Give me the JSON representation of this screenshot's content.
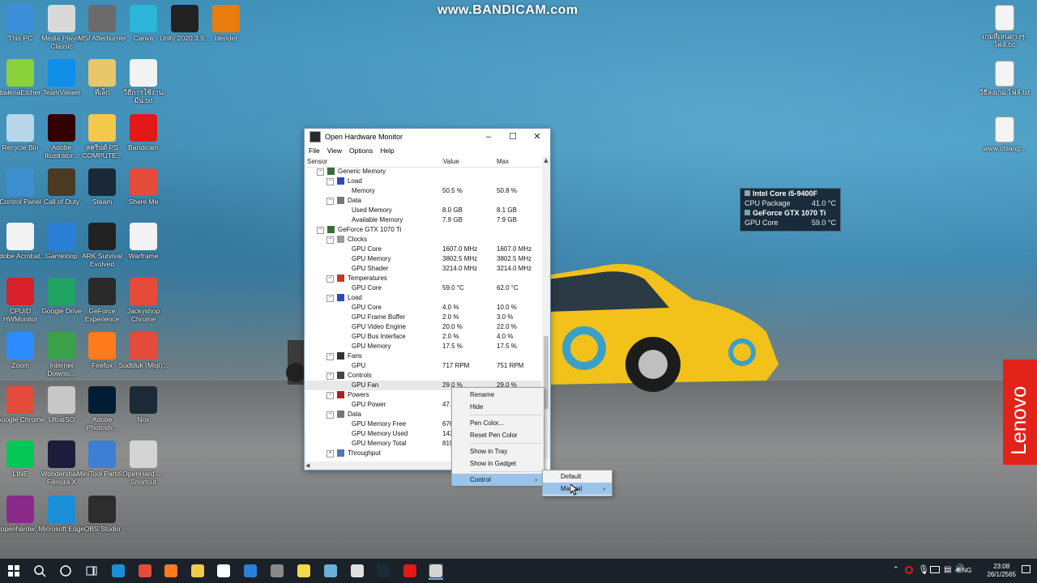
{
  "watermark": "www.BANDICAM.com",
  "brand_banner": "Lenovo",
  "desktop_left": [
    {
      "label": "This PC",
      "icon": "this-pc-icon",
      "color": "#3c8fd8"
    },
    {
      "label": "Media Player Classic",
      "icon": "media-player-icon",
      "color": "#d9d9d9"
    },
    {
      "label": "MSI Afterburner",
      "icon": "afterburner-icon",
      "color": "#6b6b6b"
    },
    {
      "label": "Canva",
      "icon": "canva-icon",
      "color": "#2bb5d8"
    },
    {
      "label": "Unity 2020.3.9...",
      "icon": "unity-icon",
      "color": "#222222"
    },
    {
      "label": "blender",
      "icon": "blender-icon",
      "color": "#e87d0d"
    },
    {
      "label": "balenaEtcher",
      "icon": "etcher-icon",
      "color": "#8ad13c"
    },
    {
      "label": "TeamViewer",
      "icon": "teamviewer-icon",
      "color": "#0e8ee9"
    },
    {
      "label": "ที่เล็ก",
      "icon": "shortcut-icon",
      "color": "#e8c66a"
    },
    {
      "label": "วิธีการใช้งาน มีน.txt",
      "icon": "text-file-icon",
      "color": "#f2f2f2"
    },
    {
      "label": "Recycle Bin",
      "icon": "recycle-bin-icon",
      "color": "#b8d6ea"
    },
    {
      "label": "Adobe Illustrator...",
      "icon": "illustrator-icon",
      "color": "#330000"
    },
    {
      "label": "สคริปต์ PS COMPUTE...",
      "icon": "folder-icon",
      "color": "#f3c94b"
    },
    {
      "label": "Bandicam",
      "icon": "bandicam-icon",
      "color": "#e31818"
    },
    {
      "label": "Control Panel",
      "icon": "control-panel-icon",
      "color": "#3d8fd0"
    },
    {
      "label": "Call of Duty",
      "icon": "callofduty-icon",
      "color": "#4a3a22"
    },
    {
      "label": "Steam",
      "icon": "steam-icon",
      "color": "#1b2838"
    },
    {
      "label": "Shere Me",
      "icon": "chrome-icon",
      "color": "#e44b3b"
    },
    {
      "label": "Adobe Acrobat...",
      "icon": "acrobat-icon",
      "color": "#f2f2f2"
    },
    {
      "label": "Gameloop",
      "icon": "gameloop-icon",
      "color": "#2b7fd8"
    },
    {
      "label": "ARK Survival Evolved",
      "icon": "ark-icon",
      "color": "#222222"
    },
    {
      "label": "Warframe",
      "icon": "warframe-icon",
      "color": "#f2f2f2"
    },
    {
      "label": "CPUID HWMonitor",
      "icon": "hwmonitor-icon",
      "color": "#d8202a"
    },
    {
      "label": "Google Drive",
      "icon": "drive-icon",
      "color": "#1fa463"
    },
    {
      "label": "GeForce Experience",
      "icon": "geforce-icon",
      "color": "#2a2a2a"
    },
    {
      "label": "Jackyshop Chrome",
      "icon": "chrome-icon",
      "color": "#e44b3b"
    },
    {
      "label": "Zoom",
      "icon": "zoom-icon",
      "color": "#2d8cff"
    },
    {
      "label": "Internet Downlo...",
      "icon": "idm-icon",
      "color": "#3aa04a"
    },
    {
      "label": "Firefox",
      "icon": "firefox-icon",
      "color": "#ff7a1a"
    },
    {
      "label": "Sudtiluk (Moji)...",
      "icon": "chrome-icon",
      "color": "#e44b3b"
    },
    {
      "label": "Google Chrome",
      "icon": "chrome-icon",
      "color": "#e44b3b"
    },
    {
      "label": "UltraISO",
      "icon": "ultraiso-icon",
      "color": "#c7c7c7"
    },
    {
      "label": "Adobe Photosh...",
      "icon": "photoshop-icon",
      "color": "#001d34"
    },
    {
      "label": "Nox",
      "icon": "nox-icon",
      "color": "#1a2a36"
    },
    {
      "label": "LINE",
      "icon": "line-icon",
      "color": "#06c755"
    },
    {
      "label": "Wondershare Filmora X",
      "icon": "filmora-icon",
      "color": "#1d1d3b"
    },
    {
      "label": "MiniTool Partiti...",
      "icon": "minitool-icon",
      "color": "#3d7fd3"
    },
    {
      "label": "OpenHard... - Shortcut",
      "icon": "openhardware-icon",
      "color": "#d4d4d4"
    },
    {
      "label": "openhardw...",
      "icon": "winrar-icon",
      "color": "#8a2b8a"
    },
    {
      "label": "Microsoft Edge",
      "icon": "edge-icon",
      "color": "#1a8fd8"
    },
    {
      "label": "OBS Studio",
      "icon": "obs-icon",
      "color": "#2d2d2d"
    }
  ],
  "desktop_right": [
    {
      "label": "เกมที่เล่นต่างๆ-ไฟล์.txt",
      "icon": "text-file-icon"
    },
    {
      "label": "วิธีลงเกม ไฟล์.txt",
      "icon": "text-file-icon"
    },
    {
      "label": "www.chiang...",
      "icon": "text-file-icon"
    }
  ],
  "window": {
    "title": "Open Hardware Monitor",
    "menu": [
      "File",
      "View",
      "Options",
      "Help"
    ],
    "columns": {
      "sensor": "Sensor",
      "value": "Value",
      "max": "Max"
    },
    "rows": [
      {
        "indent": 2,
        "exp": "-",
        "icon": "memory-icon",
        "name": "Generic Memory",
        "value": "",
        "max": ""
      },
      {
        "indent": 3,
        "exp": "-",
        "icon": "load-icon",
        "name": "Load",
        "value": "",
        "max": ""
      },
      {
        "indent": 4,
        "exp": "",
        "icon": "",
        "name": "Memory",
        "value": "50.5 %",
        "max": "50.8 %"
      },
      {
        "indent": 3,
        "exp": "-",
        "icon": "data-icon",
        "name": "Data",
        "value": "",
        "max": ""
      },
      {
        "indent": 4,
        "exp": "",
        "icon": "",
        "name": "Used Memory",
        "value": "8.0 GB",
        "max": "8.1 GB"
      },
      {
        "indent": 4,
        "exp": "",
        "icon": "",
        "name": "Available Memory",
        "value": "7.9 GB",
        "max": "7.9 GB"
      },
      {
        "indent": 2,
        "exp": "-",
        "icon": "gpu-icon",
        "name": "GeForce GTX 1070 Ti",
        "value": "",
        "max": ""
      },
      {
        "indent": 3,
        "exp": "-",
        "icon": "clock-icon",
        "name": "Clocks",
        "value": "",
        "max": ""
      },
      {
        "indent": 4,
        "exp": "",
        "icon": "",
        "name": "GPU Core",
        "value": "1607.0 MHz",
        "max": "1607.0 MHz"
      },
      {
        "indent": 4,
        "exp": "",
        "icon": "",
        "name": "GPU Memory",
        "value": "3802.5 MHz",
        "max": "3802.5 MHz"
      },
      {
        "indent": 4,
        "exp": "",
        "icon": "",
        "name": "GPU Shader",
        "value": "3214.0 MHz",
        "max": "3214.0 MHz"
      },
      {
        "indent": 3,
        "exp": "-",
        "icon": "temperature-icon",
        "name": "Temperatures",
        "value": "",
        "max": ""
      },
      {
        "indent": 4,
        "exp": "",
        "icon": "",
        "name": "GPU Core",
        "value": "59.0 °C",
        "max": "62.0 °C"
      },
      {
        "indent": 3,
        "exp": "-",
        "icon": "load-icon",
        "name": "Load",
        "value": "",
        "max": ""
      },
      {
        "indent": 4,
        "exp": "",
        "icon": "",
        "name": "GPU Core",
        "value": "4.0 %",
        "max": "10.0 %"
      },
      {
        "indent": 4,
        "exp": "",
        "icon": "",
        "name": "GPU Frame Buffer",
        "value": "2.0 %",
        "max": "3.0 %"
      },
      {
        "indent": 4,
        "exp": "",
        "icon": "",
        "name": "GPU Video Engine",
        "value": "20.0 %",
        "max": "22.0 %"
      },
      {
        "indent": 4,
        "exp": "",
        "icon": "",
        "name": "GPU Bus Interface",
        "value": "2.0 %",
        "max": "4.0 %"
      },
      {
        "indent": 4,
        "exp": "",
        "icon": "",
        "name": "GPU Memory",
        "value": "17.5 %",
        "max": "17.5 %"
      },
      {
        "indent": 3,
        "exp": "-",
        "icon": "fan-icon",
        "name": "Fans",
        "value": "",
        "max": ""
      },
      {
        "indent": 4,
        "exp": "",
        "icon": "",
        "name": "GPU",
        "value": "717 RPM",
        "max": "751 RPM"
      },
      {
        "indent": 3,
        "exp": "-",
        "icon": "controls-icon",
        "name": "Controls",
        "value": "",
        "max": ""
      },
      {
        "indent": 4,
        "exp": "",
        "icon": "",
        "name": "GPU Fan",
        "value": "29.0 %",
        "max": "29.0 %",
        "selected": true
      },
      {
        "indent": 3,
        "exp": "-",
        "icon": "power-icon",
        "name": "Powers",
        "value": "",
        "max": ""
      },
      {
        "indent": 4,
        "exp": "",
        "icon": "",
        "name": "GPU Power",
        "value": "47.",
        "max": ""
      },
      {
        "indent": 3,
        "exp": "-",
        "icon": "data-icon",
        "name": "Data",
        "value": "",
        "max": ""
      },
      {
        "indent": 4,
        "exp": "",
        "icon": "",
        "name": "GPU Memory Free",
        "value": "676",
        "max": ""
      },
      {
        "indent": 4,
        "exp": "",
        "icon": "",
        "name": "GPU Memory Used",
        "value": "143",
        "max": ""
      },
      {
        "indent": 4,
        "exp": "",
        "icon": "",
        "name": "GPU Memory Total",
        "value": "819",
        "max": ""
      },
      {
        "indent": 3,
        "exp": "+",
        "icon": "throughput-icon",
        "name": "Throughput",
        "value": "",
        "max": ""
      }
    ]
  },
  "context_menu": {
    "items": [
      "Rename",
      "Hide",
      "Pen Color...",
      "Reset Pen Color",
      "Show in Tray",
      "Show in Gadget",
      "Control"
    ],
    "submenu": [
      "Default",
      "Manual"
    ]
  },
  "gadget": {
    "cpu_name": "Intel Core i5-9400F",
    "cpu_label": "CPU Package",
    "cpu_value": "41.0 °C",
    "gpu_name": "GeForce GTX 1070 Ti",
    "gpu_label": "GPU Core",
    "gpu_value": "59.0 °C"
  },
  "taskbar": {
    "apps": [
      "start-icon",
      "search-icon",
      "cortana-icon",
      "task-view-icon",
      "edge-icon",
      "chrome-icon",
      "firefox-icon",
      "file-explorer-icon",
      "store-icon",
      "mail-icon",
      "calculator-icon",
      "sticky-notes-icon",
      "vpn-icon",
      "paint-icon",
      "nox-icon",
      "bandicam-icon",
      "openhardware-icon"
    ],
    "language": "ENG",
    "time": "23:08",
    "date": "26/1/2565"
  },
  "colors": {
    "menu_highlight": "#9bc4ea",
    "taskbar": "#1a2129",
    "bandicam_red": "#e31818",
    "accent": "#0078d7"
  }
}
